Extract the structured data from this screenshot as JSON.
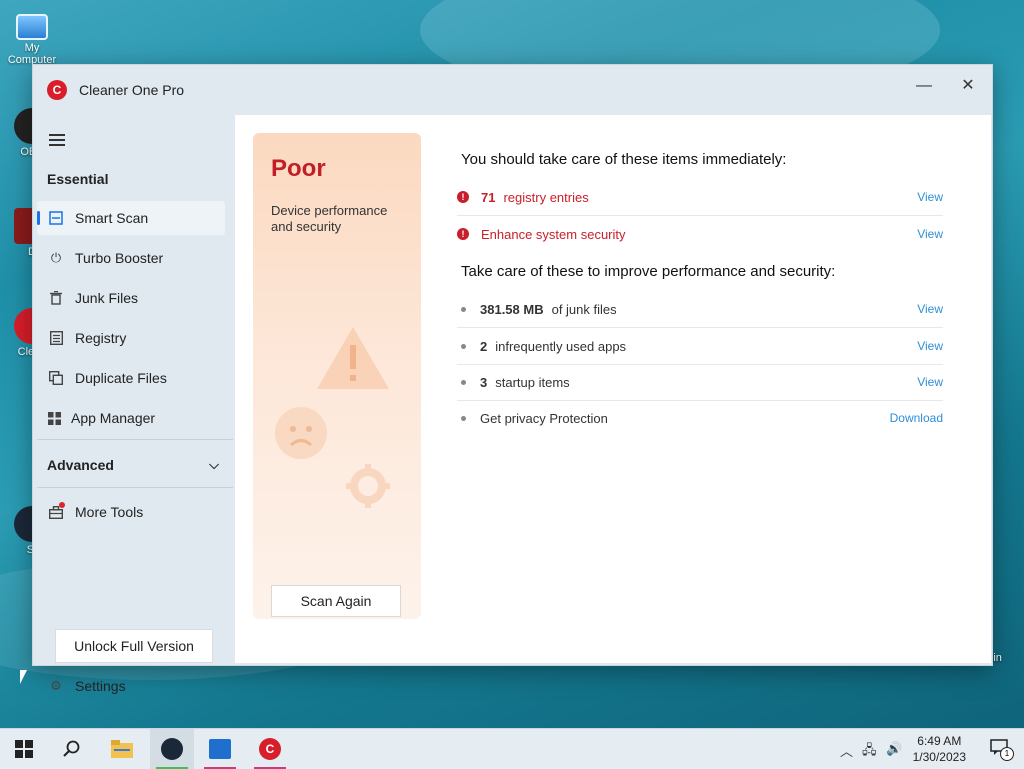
{
  "desktop": {
    "icons": [
      {
        "label": "My Computer",
        "name": "my-computer"
      },
      {
        "label": "OBS",
        "name": "obs"
      },
      {
        "label": "D",
        "name": "desktop-shortcut-d"
      },
      {
        "label": "Clean",
        "name": "cleaner-shortcut"
      },
      {
        "label": "St",
        "name": "steam-shortcut"
      }
    ],
    "recycle_bin_label": "Bin"
  },
  "window": {
    "title": "Cleaner One Pro",
    "minimize_icon": "minimize-icon",
    "close_icon": "close-icon"
  },
  "sidebar": {
    "section_essential": "Essential",
    "items": [
      {
        "label": "Smart Scan",
        "icon": "smart-scan-icon",
        "active": true
      },
      {
        "label": "Turbo Booster",
        "icon": "power-icon"
      },
      {
        "label": "Junk Files",
        "icon": "trash-icon"
      },
      {
        "label": "Registry",
        "icon": "registry-icon"
      },
      {
        "label": "Duplicate Files",
        "icon": "duplicate-icon"
      },
      {
        "label": "App Manager",
        "icon": "grid-icon"
      }
    ],
    "section_advanced": "Advanced",
    "more_tools": "More Tools",
    "unlock_button": "Unlock Full Version",
    "settings": "Settings"
  },
  "status": {
    "rating": "Poor",
    "subtitle": "Device performance and security",
    "scan_again": "Scan Again"
  },
  "results": {
    "heading_immediate": "You should take care of these items immediately:",
    "immediate": [
      {
        "count": "71",
        "text": "registry entries",
        "action": "View"
      },
      {
        "count": "",
        "text": "Enhance system security",
        "action": "View"
      }
    ],
    "heading_improve": "Take care of these to improve performance and security:",
    "improve": [
      {
        "count": "381.58 MB",
        "text": "of junk files",
        "action": "View"
      },
      {
        "count": "2",
        "text": "infrequently used apps",
        "action": "View"
      },
      {
        "count": "3",
        "text": "startup items",
        "action": "View"
      },
      {
        "count": "",
        "text": "Get privacy Protection",
        "action": "Download"
      }
    ]
  },
  "taskbar": {
    "time": "6:49 AM",
    "date": "1/30/2023",
    "notification_count": "1"
  },
  "colors": {
    "accent_red": "#c8202b",
    "link_blue": "#2f8ed6",
    "active_indicator": "#1a73e8"
  }
}
